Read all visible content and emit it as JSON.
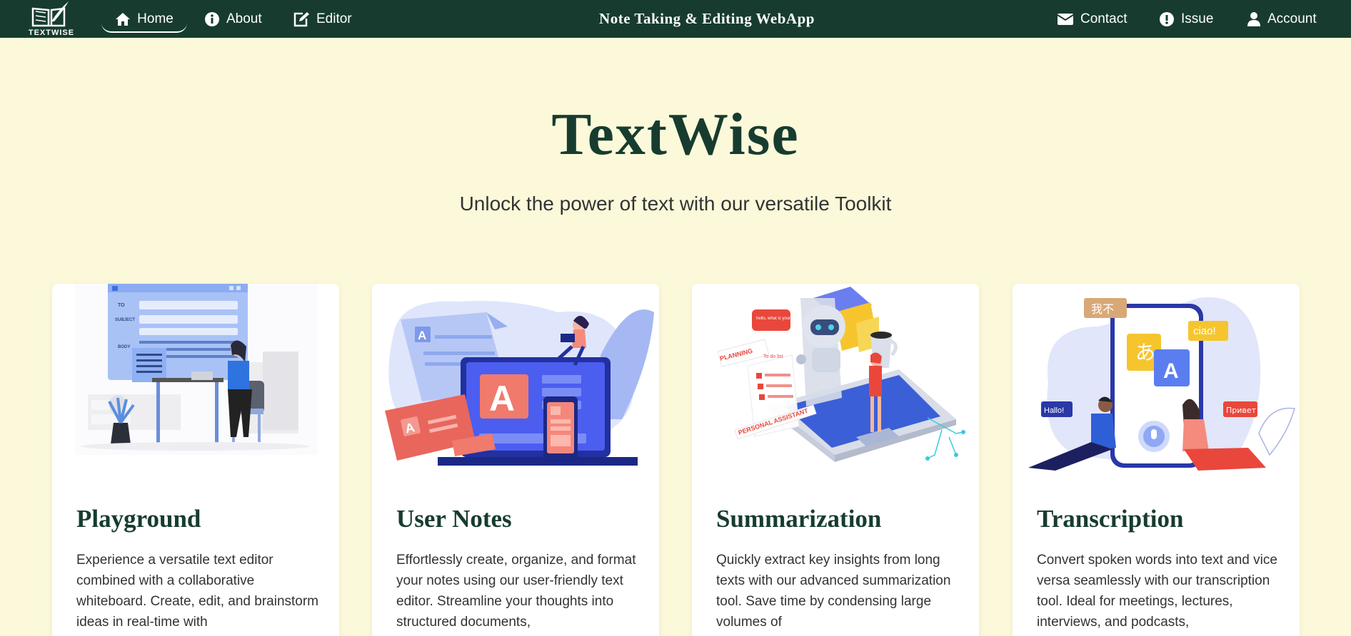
{
  "brand": {
    "logo_text": "TEXTWISE"
  },
  "nav": {
    "home": "Home",
    "about": "About",
    "editor": "Editor",
    "title": "Note Taking & Editing WebApp",
    "contact": "Contact",
    "issue": "Issue",
    "account": "Account"
  },
  "hero": {
    "title": "TextWise",
    "subtitle": "Unlock the power of text with our versatile Toolkit"
  },
  "cards": [
    {
      "title": "Playground",
      "text": "Experience a versatile text editor combined with a collaborative whiteboard. Create, edit, and brainstorm ideas in real-time with"
    },
    {
      "title": "User Notes",
      "text": "Effortlessly create, organize, and format your notes using our user-friendly text editor. Streamline your thoughts into structured documents,"
    },
    {
      "title": "Summarization",
      "text": "Quickly extract key insights from long texts with our advanced summarization tool. Save time by condensing large volumes of"
    },
    {
      "title": "Transcription",
      "text": "Convert spoken words into text and vice versa seamlessly with our transcription tool. Ideal for meetings, lectures, interviews, and podcasts,"
    }
  ],
  "illustrations": {
    "card1": {
      "labels": [
        "TO",
        "SUBJECT",
        "BODY"
      ]
    },
    "card2": {
      "letter": "A"
    },
    "card3": {
      "labels": [
        "PLANNING",
        "To do list",
        "PERSONAL ASSISTANT",
        "hello, what is your plan?"
      ]
    },
    "card4": {
      "labels": [
        "我不",
        "ciao!",
        "あ",
        "A",
        "Hallo!",
        "Привет"
      ]
    }
  },
  "colors": {
    "nav_bg": "#173c2f",
    "page_bg": "#fbf9da",
    "heading": "#173c2f"
  }
}
